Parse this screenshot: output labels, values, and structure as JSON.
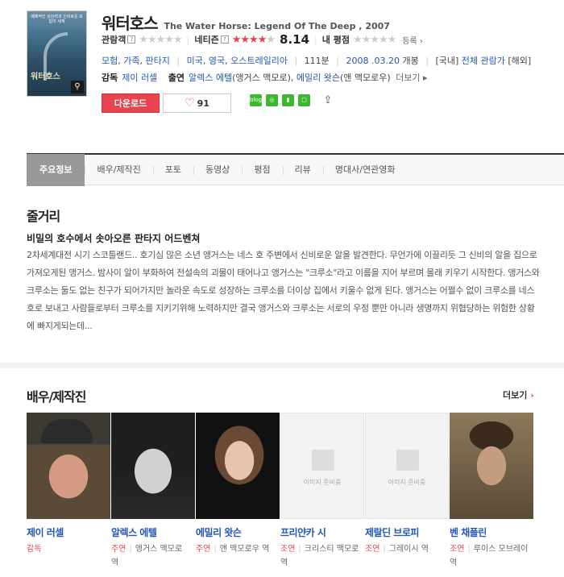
{
  "movie": {
    "poster_text": "매혹적인 상상력과 신비로운 모험의 세계",
    "poster_name": "워터호스",
    "title_ko": "워터호스",
    "title_en": "The Water Horse: Legend Of The Deep , 2007"
  },
  "ratings": {
    "audience_label": "관람객",
    "netizen_label": "네티즌",
    "netizen_score": "8.14",
    "netizen_stars": 4,
    "my_label": "내 평점",
    "register": "등록"
  },
  "info": {
    "genres": [
      "모험",
      "가족",
      "판타지"
    ],
    "countries": [
      "미국",
      "영국",
      "오스트레일리아"
    ],
    "runtime": "111분",
    "release": "2008 .03.20",
    "release_suffix": "개봉",
    "rating_country": "[국내]",
    "rating": "전체 관람가",
    "rating_overseas": "[해외]"
  },
  "credits": {
    "director_label": "감독",
    "director": "제이 러셀",
    "cast_label": "출연",
    "cast_1": "알렉스 에텔",
    "cast_1_role": "(앵거스 맥모로),",
    "cast_2": "에밀리 왓슨",
    "cast_2_role": "(앤 맥모로우)",
    "more": "더보기"
  },
  "buttons": {
    "download": "다운로드",
    "like_count": "91"
  },
  "share_icons": [
    "blog",
    "cafe",
    "book",
    "me"
  ],
  "tabs": [
    "주요정보",
    "배우/제작진",
    "포토",
    "동영상",
    "평점",
    "리뷰",
    "명대사/연관영화"
  ],
  "synopsis": {
    "heading": "줄거리",
    "subtitle": "비밀의 호수에서 솟아오른 판타지 어드벤쳐",
    "body": "2차세계대전 시기 스코틀랜드.. 호기심 많은 소년 앵거스는 네스 호 주변에서 신비로운 알을 발견한다. 무언가에 이끌리듯 그 신비의 알을 집으로 가져오게된 앵거스. 밤사이 알이 부화하여 전설속의 괴물이 태어나고 앵거스는 \"크루소\"라고 이름을 지어 부르며 몰래 키우기 시작한다. 앵거스와 크루소는 둘도 없는 친구가 되어가지만 놀라운 속도로 성장하는 크루소를 더이상 집에서 키울수 없게 된다. 앵거스는 어쩔수 없이 크루소를 네스 호로 보내고 사람들로부터 크루소를 지키기위해 노력하지만 결국 앵거스와 크루소는 서로의 우정 뿐만 아니라 생명까지 위협당하는 위험한 상황에 빠지게되는데..."
  },
  "cast_section": {
    "heading": "배우/제작진",
    "more": "더보기",
    "placeholder": "이미지 준비중",
    "people": [
      {
        "name": "제이 러셀",
        "role": "감독",
        "char": ""
      },
      {
        "name": "알렉스 에텔",
        "role": "주연",
        "char": "앵거스 맥모로 역"
      },
      {
        "name": "에밀리 왓슨",
        "role": "주연",
        "char": "앤 맥모로우 역"
      },
      {
        "name": "프리얀카 시",
        "role": "조연",
        "char": "크리스티 맥모로 역"
      },
      {
        "name": "제랄딘 브로피",
        "role": "조연",
        "char": "그레이시 역"
      },
      {
        "name": "벤 채플린",
        "role": "조연",
        "char": "루이스 모브레이 역"
      }
    ]
  }
}
